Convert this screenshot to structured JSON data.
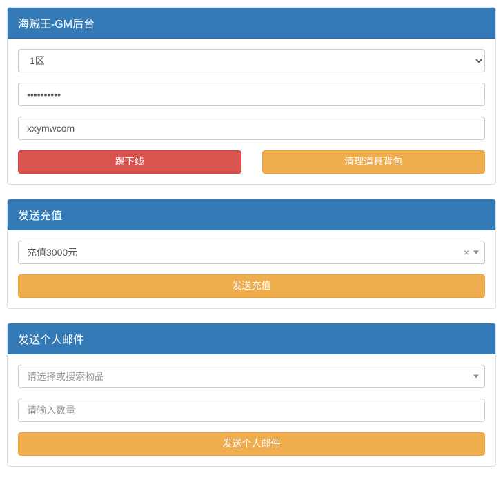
{
  "panel1": {
    "title": "海贼王-GM后台",
    "zone_selected": "1区",
    "password_value": "••••••••••",
    "username_value": "xxymwcom",
    "kick_button": "踢下线",
    "clear_bag_button": "清理道具背包"
  },
  "panel2": {
    "title": "发送充值",
    "recharge_selected": "充值3000元",
    "send_button": "发送充值"
  },
  "panel3": {
    "title": "发送个人邮件",
    "item_placeholder": "请选择或搜索物品",
    "qty_placeholder": "请输入数量",
    "send_button": "发送个人邮件"
  }
}
